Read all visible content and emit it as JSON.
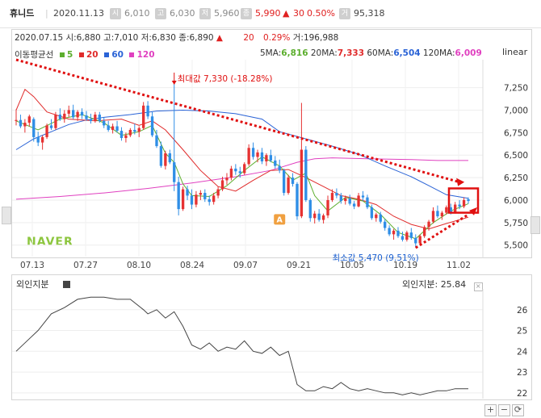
{
  "header": {
    "name": "휴니드",
    "date": "2020.11.13",
    "open_label": "시",
    "open": "6,010",
    "high_label": "고",
    "high": "6,030",
    "low_label": "저",
    "low": "5,960",
    "close_label": "종",
    "close": "5,990",
    "change_arrow": "▲",
    "change": "30",
    "change_pct": "0.50%",
    "volume_label": "거",
    "volume": "95,318"
  },
  "info": {
    "date": "2020.07.15",
    "open": "시:6,880",
    "high": "고:7,010",
    "low": "저:6,830",
    "close": "종:6,890",
    "arrow": "▲",
    "change": "20",
    "change_pct": "0.29%",
    "volume": "거:196,988"
  },
  "ma_legend": {
    "title": "이동평균선",
    "periods": [
      "5",
      "20",
      "60",
      "120"
    ],
    "labels": [
      "5MA:",
      "20MA:",
      "60MA:",
      "120MA:"
    ],
    "values": [
      "6,816",
      "7,333",
      "6,504",
      "6,009"
    ]
  },
  "scale_label": "linear",
  "brand": "NAVER",
  "annotations": {
    "max_label": "최대값 7,330 (-18.28%)",
    "min_label": "최소값 5,470 (9.51%)",
    "marker": "A"
  },
  "colors": {
    "up": "#e63232",
    "down": "#2f8ee6",
    "ma5": "#5cae2e",
    "ma20": "#e02b2b",
    "ma60": "#2a63d6",
    "ma120": "#e040c0",
    "foreign": "#444444",
    "trend": "#e01010"
  },
  "chart_data": [
    {
      "type": "candlestick",
      "x_ticks": [
        "07.13",
        "07.27",
        "08.10",
        "08.24",
        "09.07",
        "09.21",
        "10.05",
        "10.19",
        "11.02"
      ],
      "y_ticks": [
        5500,
        5750,
        6000,
        6250,
        6500,
        6750,
        7000,
        7250
      ],
      "ylim": [
        5390,
        7560
      ],
      "candles": [
        [
          6880,
          7010,
          6830,
          6890
        ],
        [
          6890,
          6950,
          6800,
          6820
        ],
        [
          6820,
          6900,
          6750,
          6860
        ],
        [
          6860,
          6950,
          6820,
          6930
        ],
        [
          6900,
          6920,
          6650,
          6700
        ],
        [
          6700,
          6760,
          6600,
          6640
        ],
        [
          6640,
          6720,
          6560,
          6700
        ],
        [
          6700,
          6850,
          6680,
          6830
        ],
        [
          6830,
          6900,
          6780,
          6800
        ],
        [
          6800,
          6980,
          6780,
          6950
        ],
        [
          6950,
          7020,
          6880,
          6900
        ],
        [
          6900,
          7000,
          6860,
          6960
        ],
        [
          6960,
          7050,
          6920,
          7000
        ],
        [
          7000,
          7060,
          6900,
          6920
        ],
        [
          6920,
          7000,
          6880,
          6980
        ],
        [
          6980,
          7020,
          6900,
          6940
        ],
        [
          6940,
          6990,
          6880,
          6900
        ],
        [
          6900,
          6960,
          6850,
          6880
        ],
        [
          6880,
          6980,
          6860,
          6950
        ],
        [
          6950,
          6980,
          6860,
          6880
        ],
        [
          6880,
          6920,
          6800,
          6830
        ],
        [
          6830,
          6880,
          6760,
          6780
        ],
        [
          6780,
          6850,
          6740,
          6820
        ],
        [
          6820,
          6880,
          6750,
          6770
        ],
        [
          6770,
          6810,
          6660,
          6690
        ],
        [
          6690,
          6750,
          6640,
          6720
        ],
        [
          6720,
          6800,
          6700,
          6780
        ],
        [
          6780,
          6850,
          6730,
          6760
        ],
        [
          6760,
          6820,
          6700,
          6800
        ],
        [
          6800,
          7090,
          6780,
          7050
        ],
        [
          7050,
          7100,
          6900,
          6930
        ],
        [
          6930,
          6980,
          6700,
          6720
        ],
        [
          6720,
          6780,
          6580,
          6600
        ],
        [
          6600,
          6650,
          6360,
          6380
        ],
        [
          6380,
          6550,
          6340,
          6520
        ],
        [
          6520,
          6560,
          6400,
          6420
        ],
        [
          6420,
          7330,
          6100,
          6200
        ],
        [
          6200,
          6260,
          5830,
          5900
        ],
        [
          5900,
          6150,
          5880,
          6120
        ],
        [
          6120,
          6160,
          6000,
          6050
        ],
        [
          6050,
          6120,
          5900,
          5950
        ],
        [
          5950,
          6100,
          5920,
          6060
        ],
        [
          6060,
          6110,
          6000,
          6080
        ],
        [
          6080,
          6120,
          5980,
          6010
        ],
        [
          6010,
          6050,
          5940,
          5980
        ],
        [
          5980,
          6080,
          5950,
          6050
        ],
        [
          6050,
          6150,
          6020,
          6120
        ],
        [
          6120,
          6260,
          6100,
          6220
        ],
        [
          6220,
          6300,
          6170,
          6250
        ],
        [
          6250,
          6380,
          6220,
          6350
        ],
        [
          6350,
          6400,
          6280,
          6320
        ],
        [
          6320,
          6370,
          6250,
          6300
        ],
        [
          6300,
          6420,
          6280,
          6400
        ],
        [
          6400,
          6620,
          6380,
          6580
        ],
        [
          6580,
          6640,
          6450,
          6480
        ],
        [
          6480,
          6560,
          6420,
          6530
        ],
        [
          6530,
          6580,
          6400,
          6430
        ],
        [
          6430,
          6520,
          6380,
          6500
        ],
        [
          6500,
          6560,
          6420,
          6440
        ],
        [
          6440,
          6490,
          6350,
          6380
        ],
        [
          6380,
          6450,
          6300,
          6330
        ],
        [
          6330,
          6350,
          6050,
          6080
        ],
        [
          6080,
          6280,
          6060,
          6250
        ],
        [
          6250,
          6300,
          6150,
          6180
        ],
        [
          6180,
          6200,
          5780,
          5820
        ],
        [
          5820,
          7080,
          5800,
          6560
        ],
        [
          6560,
          6600,
          5980,
          6000
        ],
        [
          6000,
          6020,
          5760,
          5800
        ],
        [
          5800,
          5880,
          5740,
          5850
        ],
        [
          5850,
          5900,
          5760,
          5780
        ],
        [
          5780,
          5850,
          5740,
          5830
        ],
        [
          5830,
          6050,
          5800,
          6000
        ],
        [
          6000,
          6120,
          5980,
          6080
        ],
        [
          6080,
          6130,
          6020,
          6050
        ],
        [
          6050,
          6080,
          5960,
          5990
        ],
        [
          5990,
          6050,
          5950,
          6020
        ],
        [
          6020,
          6060,
          5940,
          5960
        ],
        [
          5960,
          5990,
          5900,
          5930
        ],
        [
          5930,
          6080,
          5920,
          6050
        ],
        [
          6050,
          6100,
          5990,
          6030
        ],
        [
          6030,
          6060,
          5900,
          5920
        ],
        [
          5920,
          5950,
          5780,
          5800
        ],
        [
          5800,
          5860,
          5760,
          5840
        ],
        [
          5840,
          5870,
          5740,
          5760
        ],
        [
          5760,
          5790,
          5660,
          5690
        ],
        [
          5690,
          5720,
          5600,
          5620
        ],
        [
          5620,
          5680,
          5560,
          5660
        ],
        [
          5660,
          5700,
          5580,
          5600
        ],
        [
          5600,
          5650,
          5540,
          5560
        ],
        [
          5560,
          5660,
          5540,
          5640
        ],
        [
          5640,
          5690,
          5560,
          5580
        ],
        [
          5580,
          5620,
          5470,
          5520
        ],
        [
          5520,
          5620,
          5500,
          5600
        ],
        [
          5600,
          5720,
          5580,
          5700
        ],
        [
          5700,
          5780,
          5660,
          5760
        ],
        [
          5760,
          5920,
          5740,
          5880
        ],
        [
          5880,
          5940,
          5800,
          5820
        ],
        [
          5820,
          5880,
          5780,
          5860
        ],
        [
          5860,
          5940,
          5840,
          5920
        ],
        [
          5920,
          5960,
          5840,
          5860
        ],
        [
          5860,
          5980,
          5850,
          5950
        ],
        [
          5950,
          6000,
          5900,
          5930
        ],
        [
          5930,
          6030,
          5910,
          6000
        ],
        [
          6010,
          6030,
          5960,
          5990
        ]
      ],
      "ma5": [
        [
          0,
          6880
        ],
        [
          5,
          6780
        ],
        [
          10,
          6900
        ],
        [
          15,
          6950
        ],
        [
          20,
          6860
        ],
        [
          24,
          6720
        ],
        [
          28,
          6760
        ],
        [
          31,
          6830
        ],
        [
          34,
          6520
        ],
        [
          36,
          6420
        ],
        [
          38,
          6180
        ],
        [
          40,
          6050
        ],
        [
          44,
          6040
        ],
        [
          48,
          6160
        ],
        [
          52,
          6330
        ],
        [
          56,
          6480
        ],
        [
          60,
          6380
        ],
        [
          63,
          6220
        ],
        [
          66,
          6300
        ],
        [
          68,
          6050
        ],
        [
          71,
          5880
        ],
        [
          75,
          6030
        ],
        [
          79,
          5990
        ],
        [
          83,
          5840
        ],
        [
          87,
          5640
        ],
        [
          91,
          5570
        ],
        [
          95,
          5750
        ],
        [
          99,
          5880
        ],
        [
          103,
          5960
        ]
      ],
      "ma20": [
        [
          0,
          7000
        ],
        [
          2,
          7230
        ],
        [
          4,
          7150
        ],
        [
          7,
          6980
        ],
        [
          12,
          6900
        ],
        [
          18,
          6880
        ],
        [
          24,
          6900
        ],
        [
          28,
          6830
        ],
        [
          31,
          6880
        ],
        [
          34,
          6780
        ],
        [
          38,
          6560
        ],
        [
          42,
          6330
        ],
        [
          46,
          6150
        ],
        [
          50,
          6100
        ],
        [
          54,
          6220
        ],
        [
          58,
          6330
        ],
        [
          62,
          6340
        ],
        [
          66,
          6250
        ],
        [
          70,
          6150
        ],
        [
          74,
          6050
        ],
        [
          78,
          6010
        ],
        [
          82,
          5950
        ],
        [
          86,
          5820
        ],
        [
          90,
          5730
        ],
        [
          94,
          5680
        ],
        [
          98,
          5740
        ],
        [
          103,
          5810
        ]
      ],
      "ma60": [
        [
          0,
          6560
        ],
        [
          4,
          6680
        ],
        [
          8,
          6760
        ],
        [
          12,
          6840
        ],
        [
          16,
          6890
        ],
        [
          20,
          6920
        ],
        [
          26,
          6950
        ],
        [
          32,
          6990
        ],
        [
          38,
          7000
        ],
        [
          44,
          6990
        ],
        [
          50,
          6960
        ],
        [
          56,
          6900
        ],
        [
          60,
          6760
        ],
        [
          66,
          6680
        ],
        [
          72,
          6600
        ],
        [
          78,
          6510
        ],
        [
          84,
          6380
        ],
        [
          90,
          6260
        ],
        [
          94,
          6160
        ],
        [
          98,
          6060
        ],
        [
          103,
          6020
        ]
      ],
      "ma120": [
        [
          0,
          6010
        ],
        [
          10,
          6040
        ],
        [
          20,
          6080
        ],
        [
          30,
          6130
        ],
        [
          40,
          6190
        ],
        [
          50,
          6260
        ],
        [
          58,
          6330
        ],
        [
          64,
          6420
        ],
        [
          68,
          6460
        ],
        [
          72,
          6470
        ],
        [
          80,
          6460
        ],
        [
          90,
          6450
        ],
        [
          96,
          6440
        ],
        [
          103,
          6440
        ]
      ],
      "annotations": [
        {
          "label": "최대값 7,330 (-18.28%)",
          "index": 36,
          "value": 7330
        },
        {
          "label": "최소값 5,470 (9.51%)",
          "index": 91,
          "value": 5470
        }
      ],
      "trend_lines": [
        {
          "from": [
            0,
            7560
          ],
          "to": [
            101,
            6200
          ]
        },
        {
          "from": [
            91,
            5470
          ],
          "to": [
            103,
            5840
          ]
        }
      ]
    },
    {
      "type": "line",
      "title": "외인지분",
      "last_label": "외인지분:",
      "last_value": "25.84",
      "y_ticks": [
        22,
        23,
        24,
        25,
        26
      ],
      "ylim": [
        21.8,
        27.0
      ],
      "x": [
        0,
        3,
        5,
        8,
        11,
        14,
        17,
        20,
        23,
        26,
        29,
        30,
        32,
        34,
        36,
        38,
        40,
        42,
        44,
        46,
        48,
        50,
        52,
        54,
        56,
        58,
        60,
        62,
        64,
        66,
        68,
        70,
        72,
        74,
        76,
        78,
        80,
        82,
        84,
        86,
        88,
        90,
        92,
        94,
        96,
        98,
        100,
        103
      ],
      "values": [
        24.0,
        24.6,
        25.0,
        25.8,
        26.1,
        26.5,
        26.6,
        26.6,
        26.5,
        26.5,
        26.0,
        25.8,
        26.0,
        25.6,
        25.9,
        25.2,
        24.3,
        24.1,
        24.4,
        24.0,
        24.2,
        24.1,
        24.5,
        24.0,
        23.9,
        24.2,
        23.8,
        24.0,
        22.4,
        22.1,
        22.1,
        22.3,
        22.2,
        22.5,
        22.2,
        22.1,
        22.2,
        22.1,
        22.0,
        22.0,
        21.9,
        22.0,
        21.9,
        22.0,
        22.1,
        22.1,
        22.2,
        22.2
      ]
    }
  ]
}
